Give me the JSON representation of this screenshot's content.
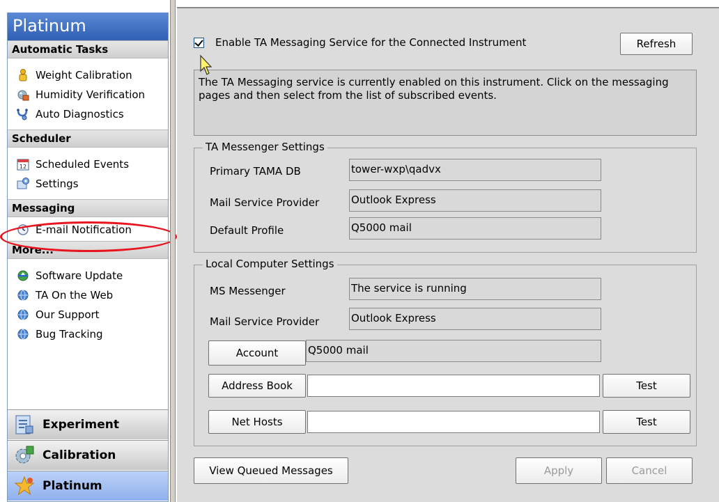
{
  "sidebar": {
    "title": "Platinum",
    "sections": [
      {
        "heading": "Automatic Tasks",
        "items": [
          {
            "label": "Weight Calibration",
            "icon": "weight-icon"
          },
          {
            "label": "Humidity Verification",
            "icon": "humidity-icon"
          },
          {
            "label": "Auto Diagnostics",
            "icon": "stethoscope-icon"
          }
        ]
      },
      {
        "heading": "Scheduler",
        "items": [
          {
            "label": "Scheduled Events",
            "icon": "calendar-icon"
          },
          {
            "label": "Settings",
            "icon": "settings-icon"
          }
        ]
      },
      {
        "heading": "Messaging",
        "items": [
          {
            "label": "E-mail Notification",
            "icon": "clock-icon"
          }
        ]
      },
      {
        "heading": "More...",
        "items": [
          {
            "label": "Software Update",
            "icon": "update-icon"
          },
          {
            "label": "TA On the Web",
            "icon": "globe-icon"
          },
          {
            "label": "Our Support",
            "icon": "globe-icon"
          },
          {
            "label": "Bug Tracking",
            "icon": "globe-icon"
          }
        ]
      }
    ],
    "modules": [
      {
        "label": "Experiment",
        "icon": "experiment-icon",
        "active": false
      },
      {
        "label": "Calibration",
        "icon": "calibration-icon",
        "active": false
      },
      {
        "label": "Platinum",
        "icon": "platinum-icon",
        "active": true
      }
    ],
    "accent_color": "#2f5fb3",
    "highlight_color": "#e8141e"
  },
  "main": {
    "enable_checkbox_label": "Enable TA Messaging Service  for the Connected Instrument",
    "enable_checked": true,
    "refresh_label": "Refresh",
    "info_text": "The TA Messaging service is currently enabled on this instrument. Click on the messaging pages and then select from the list of subscribed events.",
    "messenger_settings": {
      "title": "TA Messenger Settings",
      "primary_db_label": "Primary TAMA DB",
      "primary_db_value": "tower-wxp\\qadvx",
      "mail_provider_label": "Mail Service Provider",
      "mail_provider_value": "Outlook Express",
      "default_profile_label": "Default Profile",
      "default_profile_value": "Q5000 mail"
    },
    "local_settings": {
      "title": "Local Computer Settings",
      "ms_messenger_label": "MS Messenger",
      "ms_messenger_value": "The service is running",
      "mail_provider_label": "Mail Service Provider",
      "mail_provider_value": "Outlook Express",
      "account_button": "Account",
      "account_value": "Q5000 mail",
      "address_book_button": "Address Book",
      "address_book_value": "",
      "net_hosts_button": "Net Hosts",
      "net_hosts_value": "",
      "test_label": "Test"
    },
    "view_queued_label": "View Queued Messages",
    "apply_label": "Apply",
    "cancel_label": "Cancel"
  }
}
